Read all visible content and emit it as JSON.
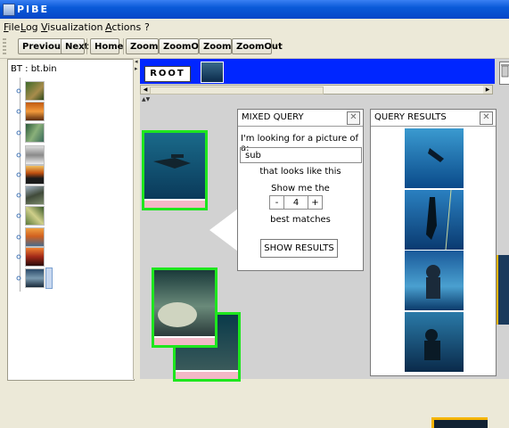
{
  "window": {
    "title": "PIBE"
  },
  "menu": [
    {
      "label": "File",
      "mnemonic": "F",
      "rest": "ile"
    },
    {
      "label": "Log",
      "mnemonic": "L",
      "rest": "og"
    },
    {
      "label": "Visualization",
      "mnemonic": "V",
      "rest": "isualization"
    },
    {
      "label": "Actions",
      "mnemonic": "A",
      "rest": "ctions"
    },
    {
      "label": "?",
      "mnemonic": "",
      "rest": "?"
    }
  ],
  "toolbar": {
    "previous": "Previous",
    "next": "Next",
    "home": "Home",
    "zoomin1": "ZoomIn",
    "zoomout1": "ZoomOut",
    "zoomin2": "ZoomIn",
    "zoomout2": "ZoomOut"
  },
  "tree": {
    "root_label": "BT : bt.bin",
    "nodes": [
      "photo-1",
      "photo-2",
      "photo-3",
      "photo-4",
      "photo-5",
      "photo-6",
      "photo-7",
      "photo-8",
      "photo-9",
      "photo-10"
    ]
  },
  "breadcrumb": {
    "root": "ROOT"
  },
  "mixed_query": {
    "title": "MIXED QUERY",
    "prompt": "I'm looking for a picture of a:",
    "input_value": "sub",
    "looks_like": "that looks like this",
    "show_me": "Show me the",
    "minus": "-",
    "count": "4",
    "plus": "+",
    "best_matches": "best matches",
    "show_results": "SHOW RESULTS"
  },
  "query_results": {
    "title": "QUERY RESULTS",
    "count": 4
  },
  "icons": {
    "close": "close-icon",
    "trash": "trash-icon",
    "app": "app-icon"
  },
  "colors": {
    "accent": "#0026ff",
    "selection_frame": "#1ee61e",
    "highlight": "#f2b8c6",
    "title_bar": "#0a5ad8"
  }
}
